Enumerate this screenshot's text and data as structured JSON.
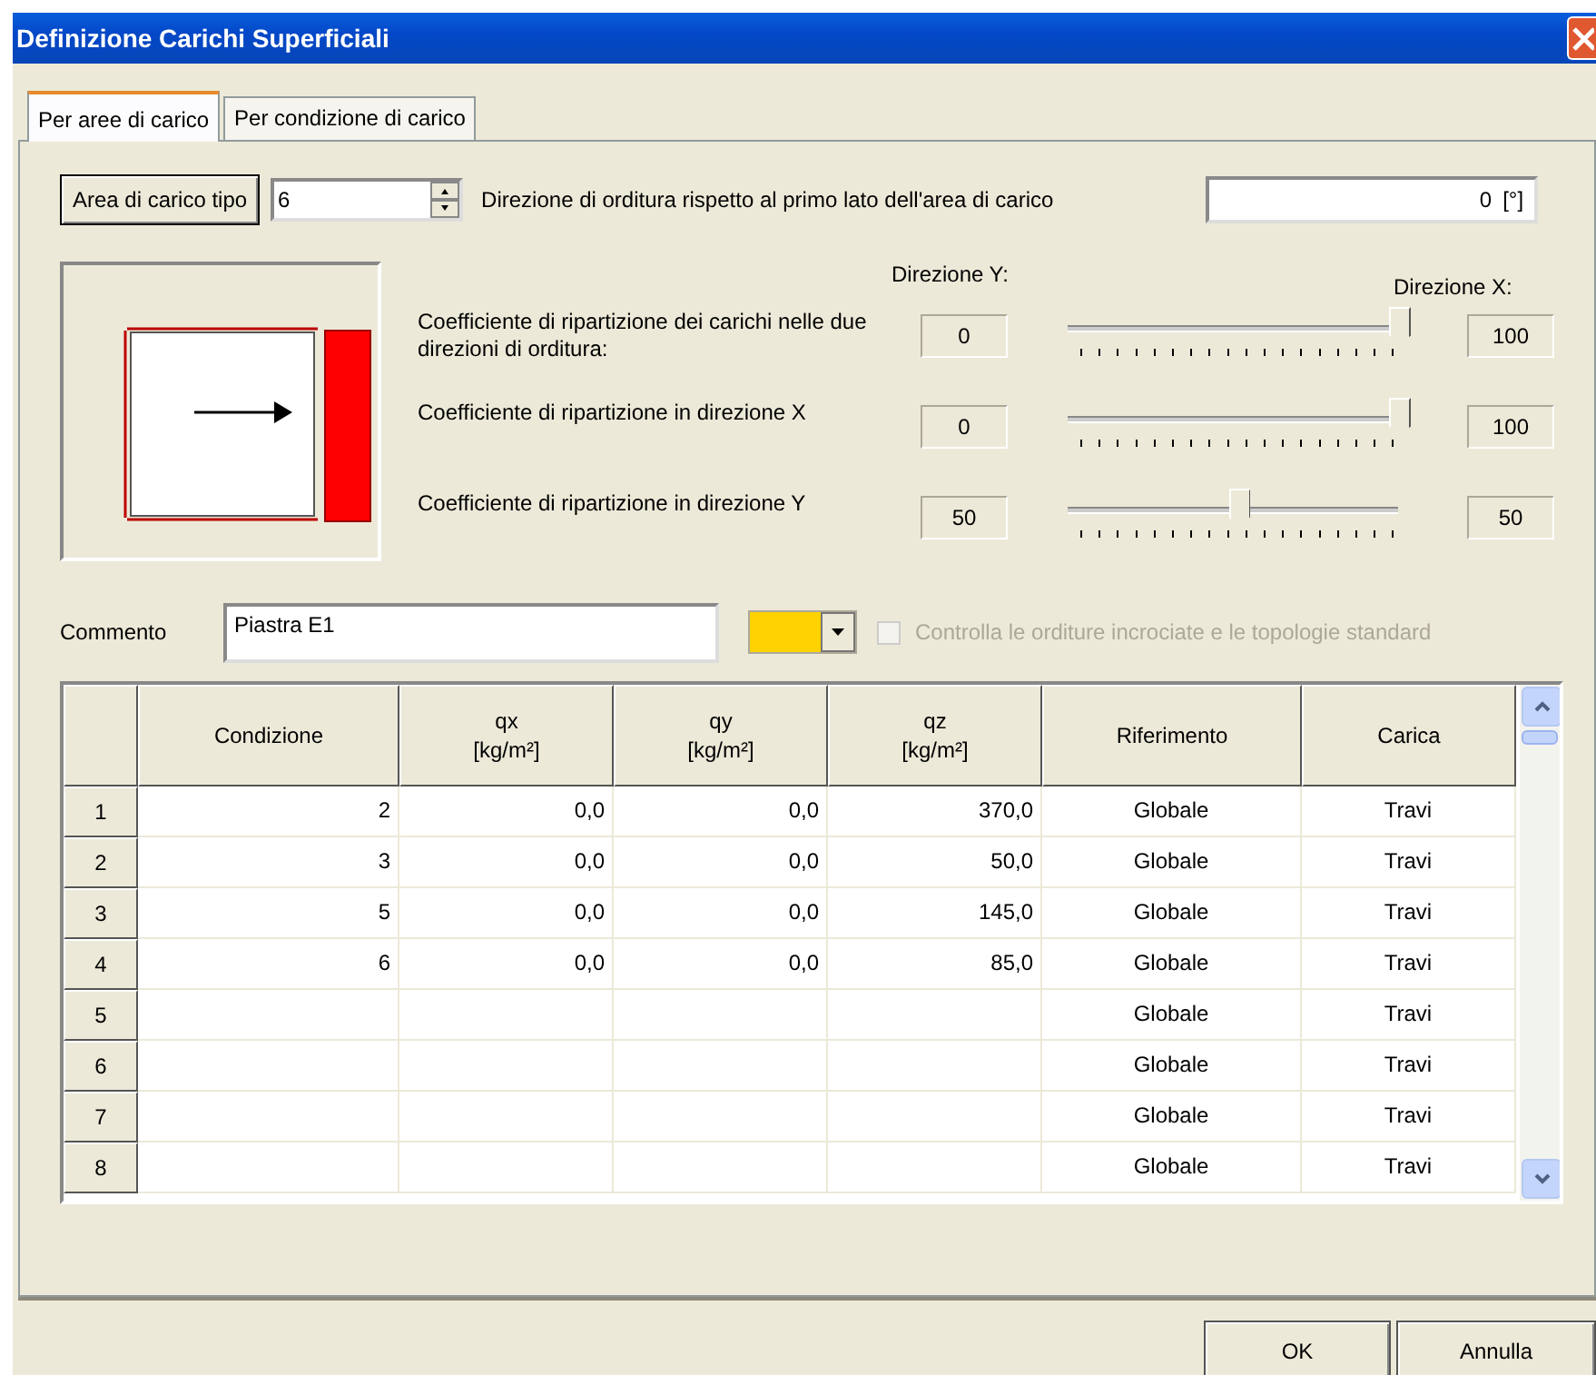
{
  "window": {
    "title": "Definizione Carichi Superficiali"
  },
  "tabs": [
    {
      "label": "Per aree di carico",
      "selected": true
    },
    {
      "label": "Per condizione di carico",
      "selected": false
    }
  ],
  "area_type": {
    "button": "Area di carico tipo",
    "value": "6"
  },
  "direction": {
    "label": "Direzione di orditura rispetto al primo lato dell'area di carico",
    "value": "0",
    "unit": "[°]"
  },
  "sliders_header": {
    "left": "Direzione Y:",
    "right": "Direzione X:"
  },
  "sliders": [
    {
      "label": "Coefficiente di ripartizione dei carichi nelle due direzioni di orditura:",
      "left_value": "0",
      "level": 1,
      "right_value": "100"
    },
    {
      "label": "Coefficiente di ripartizione in direzione X",
      "left_value": "0",
      "level": 1,
      "right_value": "100"
    },
    {
      "label": "Coefficiente di ripartizione in direzione Y",
      "left_value": "50",
      "level": 0.5,
      "right_value": "50"
    }
  ],
  "comment": {
    "label": "Commento",
    "value": "Piastra E1",
    "color": "#ffd200"
  },
  "check": {
    "label": "Controlla le orditure incrociate e le topologie standard",
    "checked": false,
    "disabled": true
  },
  "table": {
    "columns": [
      {
        "name": "Condizione"
      },
      {
        "name": "qx",
        "unit": "[kg/m²]"
      },
      {
        "name": "qy",
        "unit": "[kg/m²]"
      },
      {
        "name": "qz",
        "unit": "[kg/m²]"
      },
      {
        "name": "Riferimento"
      },
      {
        "name": "Carica"
      }
    ],
    "rows": [
      {
        "number": "1",
        "cells": [
          "2",
          "0,0",
          "0,0",
          "370,0",
          "Globale",
          "Travi"
        ]
      },
      {
        "number": "2",
        "cells": [
          "3",
          "0,0",
          "0,0",
          "50,0",
          "Globale",
          "Travi"
        ]
      },
      {
        "number": "3",
        "cells": [
          "5",
          "0,0",
          "0,0",
          "145,0",
          "Globale",
          "Travi"
        ]
      },
      {
        "number": "4",
        "cells": [
          "6",
          "0,0",
          "0,0",
          "85,0",
          "Globale",
          "Travi"
        ]
      },
      {
        "number": "5",
        "cells": [
          null,
          null,
          null,
          null,
          "Globale",
          "Travi"
        ]
      },
      {
        "number": "6",
        "cells": [
          null,
          null,
          null,
          null,
          "Globale",
          "Travi"
        ]
      },
      {
        "number": "7",
        "cells": [
          null,
          null,
          null,
          null,
          "Globale",
          "Travi"
        ]
      },
      {
        "number": "8",
        "cells": [
          null,
          null,
          null,
          null,
          "Globale",
          "Travi"
        ]
      }
    ]
  },
  "buttons": [
    "OK",
    "Annulla"
  ]
}
